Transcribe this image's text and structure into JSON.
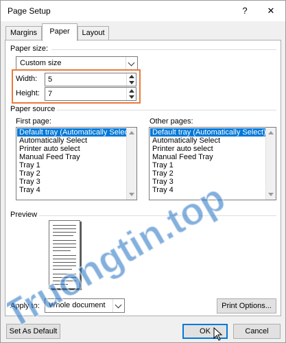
{
  "window": {
    "title": "Page Setup",
    "help_glyph": "?",
    "close_glyph": "✕"
  },
  "tabs": [
    {
      "label": "Margins"
    },
    {
      "label": "Paper",
      "active": true
    },
    {
      "label": "Layout"
    }
  ],
  "paper_size": {
    "section_label": "Paper size:",
    "selected": "Custom size",
    "width_label": "Width:",
    "width_value": "5",
    "height_label": "Height:",
    "height_value": "7"
  },
  "paper_source": {
    "section_label": "Paper source",
    "first_page_label": "First page:",
    "other_pages_label": "Other pages:",
    "first_page_items": [
      "Default tray (Automatically Select)",
      "Automatically Select",
      "Printer auto select",
      "Manual Feed Tray",
      "Tray 1",
      "Tray 2",
      "Tray 3",
      "Tray 4"
    ],
    "other_pages_items": [
      "Default tray (Automatically Select)",
      "Automatically Select",
      "Printer auto select",
      "Manual Feed Tray",
      "Tray 1",
      "Tray 2",
      "Tray 3",
      "Tray 4"
    ],
    "first_page_selected_index": 0,
    "other_pages_selected_index": 0
  },
  "preview": {
    "section_label": "Preview"
  },
  "apply": {
    "label": "Apply to:",
    "selected": "Whole document",
    "print_options_label": "Print Options..."
  },
  "footer": {
    "set_default_label": "Set As Default",
    "ok_label": "OK",
    "cancel_label": "Cancel"
  },
  "colors": {
    "selection": "#0078d7",
    "highlight_box": "#e9793d",
    "watermark": "#1f6fc1"
  },
  "watermark_text": "Truongtin.top"
}
